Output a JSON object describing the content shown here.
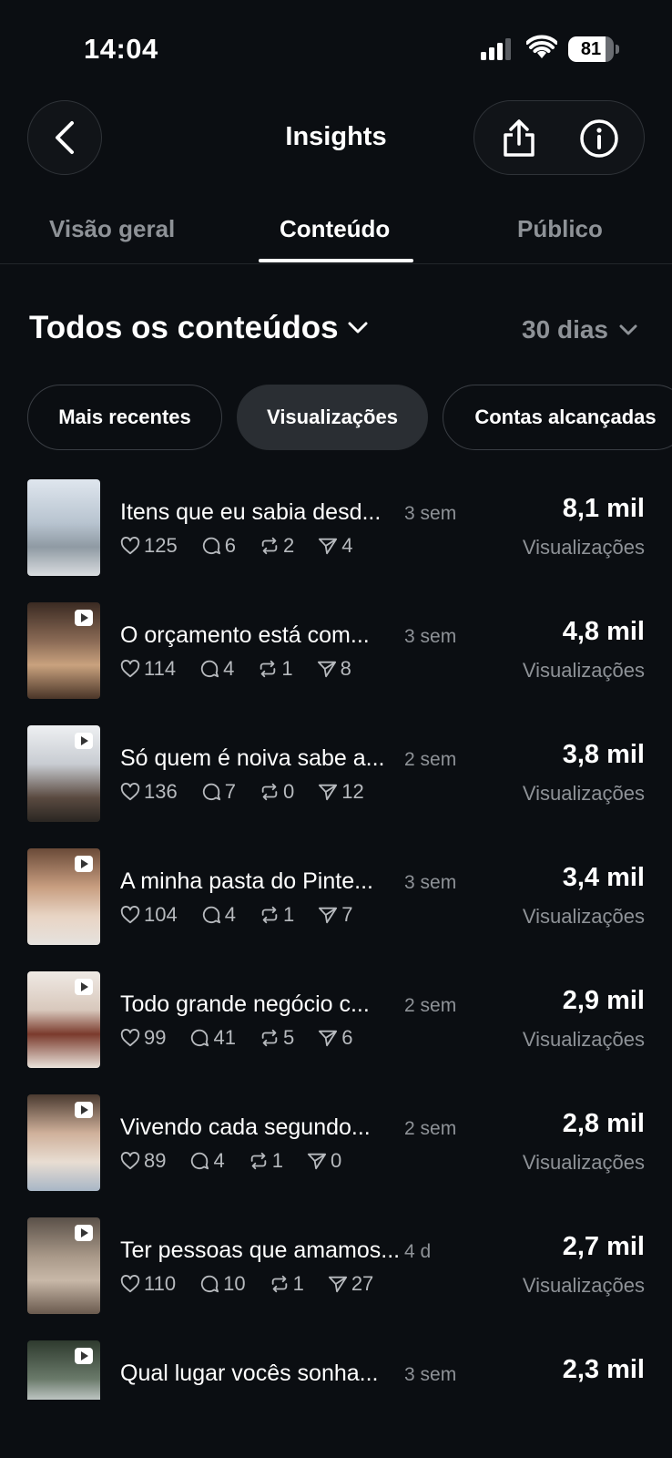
{
  "status_bar": {
    "time": "14:04",
    "battery": "81",
    "battery_fraction": 0.81
  },
  "header": {
    "title": "Insights"
  },
  "tabs": [
    {
      "label": "Visão geral"
    },
    {
      "label": "Conteúdo"
    },
    {
      "label": "Público"
    }
  ],
  "filter": {
    "content_label": "Todos os conteúdos",
    "range_label": "30 dias"
  },
  "chips": [
    {
      "label": "Mais recentes"
    },
    {
      "label": "Visualizações"
    },
    {
      "label": "Contas alcançadas"
    }
  ],
  "posts": [
    {
      "title": "Itens que eu sabia desd...",
      "age": "3 sem",
      "likes": "125",
      "comments": "6",
      "reposts": "2",
      "shares": "4",
      "value": "8,1 mil",
      "metric": "Visualizações"
    },
    {
      "title": "O orçamento está com...",
      "age": "3 sem",
      "likes": "114",
      "comments": "4",
      "reposts": "1",
      "shares": "8",
      "value": "4,8 mil",
      "metric": "Visualizações"
    },
    {
      "title": "Só quem é noiva sabe a...",
      "age": "2 sem",
      "likes": "136",
      "comments": "7",
      "reposts": "0",
      "shares": "12",
      "value": "3,8 mil",
      "metric": "Visualizações"
    },
    {
      "title": "A minha pasta do Pinte...",
      "age": "3 sem",
      "likes": "104",
      "comments": "4",
      "reposts": "1",
      "shares": "7",
      "value": "3,4 mil",
      "metric": "Visualizações"
    },
    {
      "title": "Todo grande negócio c...",
      "age": "2 sem",
      "likes": "99",
      "comments": "41",
      "reposts": "5",
      "shares": "6",
      "value": "2,9 mil",
      "metric": "Visualizações"
    },
    {
      "title": "Vivendo cada segundo...",
      "age": "2 sem",
      "likes": "89",
      "comments": "4",
      "reposts": "1",
      "shares": "0",
      "value": "2,8 mil",
      "metric": "Visualizações"
    },
    {
      "title": "Ter pessoas que amamos...",
      "age": "4 d",
      "likes": "110",
      "comments": "10",
      "reposts": "1",
      "shares": "27",
      "value": "2,7 mil",
      "metric": "Visualizações"
    },
    {
      "title": "Qual lugar vocês sonha...",
      "age": "3 sem",
      "likes": "",
      "comments": "",
      "reposts": "",
      "shares": "",
      "value": "2,3 mil",
      "metric": ""
    }
  ],
  "colors": {
    "background": "#0b0e12",
    "muted": "#8e9297",
    "chip_selected": "#2a2e33"
  }
}
